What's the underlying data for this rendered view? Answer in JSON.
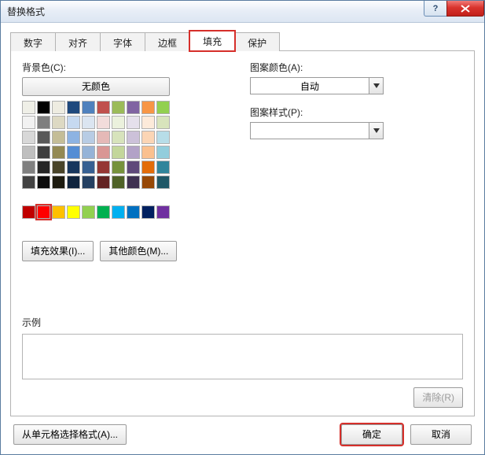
{
  "title": "替换格式",
  "tabs": [
    "数字",
    "对齐",
    "字体",
    "边框",
    "填充",
    "保护"
  ],
  "activeTab": 4,
  "bg_label": "背景色(C):",
  "no_color": "无颜色",
  "fill_effects": "填充效果(I)...",
  "more_colors": "其他颜色(M)...",
  "pattern_color_label": "图案颜色(A):",
  "pattern_color_value": "自动",
  "pattern_style_label": "图案样式(P):",
  "pattern_style_value": "",
  "example_label": "示例",
  "clear": "清除(R)",
  "from_cell": "从单元格选择格式(A)...",
  "ok": "确定",
  "cancel": "取消",
  "palette_rows": [
    [
      "#efefe7",
      "#000000",
      "#eeece1",
      "#1f497d",
      "#4f81bd",
      "#c0504d",
      "#9bbb59",
      "#8064a2",
      "#f79646",
      "#92d050"
    ],
    [
      "#f2f2f2",
      "#7f7f7f",
      "#ddd9c3",
      "#c6d9f0",
      "#dbe5f1",
      "#f2dcdb",
      "#ebf1dd",
      "#e5e0ec",
      "#fdeada",
      "#d8e4bc"
    ],
    [
      "#d8d8d8",
      "#595959",
      "#c4bd97",
      "#8db3e2",
      "#b8cce4",
      "#e5b9b7",
      "#d7e3bc",
      "#ccc1d9",
      "#fbd5b5",
      "#b7dde8"
    ],
    [
      "#bfbfbf",
      "#3f3f3f",
      "#938953",
      "#548dd4",
      "#95b3d7",
      "#d99694",
      "#c3d69b",
      "#b2a2c7",
      "#fac08f",
      "#92cddc"
    ],
    [
      "#808080",
      "#262626",
      "#494429",
      "#17365d",
      "#366092",
      "#953734",
      "#76923c",
      "#5f497a",
      "#e36c09",
      "#31859b"
    ],
    [
      "#434343",
      "#0c0c0c",
      "#1d1b10",
      "#0f243e",
      "#244061",
      "#632423",
      "#4f6228",
      "#3f3151",
      "#974806",
      "#205867"
    ],
    [
      "",
      "",
      "",
      "",
      "",
      "",
      "",
      "",
      "",
      ""
    ],
    [
      "#c00000",
      "#ff0000",
      "#ffc000",
      "#ffff00",
      "#92d050",
      "#00b050",
      "#00b0f0",
      "#0070c0",
      "#002060",
      "#7030a0"
    ]
  ],
  "selected_swatch": [
    7,
    1
  ]
}
